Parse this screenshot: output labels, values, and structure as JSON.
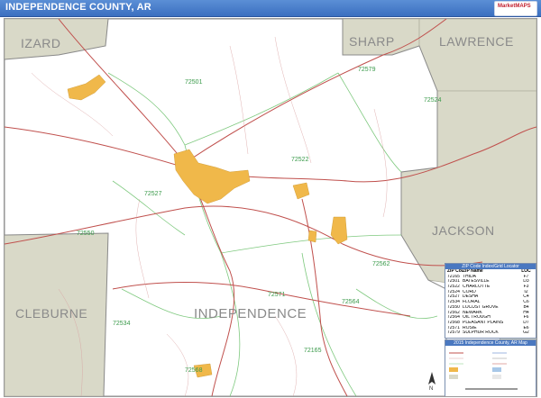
{
  "title": "INDEPENDENCE COUNTY, AR",
  "brand": {
    "name": "MarketMAPS"
  },
  "counties": {
    "izard": "IZARD",
    "sharp": "SHARP",
    "lawrence": "LAWRENCE",
    "jackson": "JACKSON",
    "cleburne": "CLEBURNE",
    "independence": "INDEPENDENCE"
  },
  "zip_labels": [
    "72501",
    "72579",
    "72524",
    "72522",
    "72527",
    "72550",
    "72562",
    "72571",
    "72534",
    "72564",
    "72165",
    "72568"
  ],
  "zip_table": {
    "title": "ZIP Code Index/Grid Locator",
    "headers": [
      "ZIP Code",
      "ZIP Name",
      "LOC"
    ],
    "rows": [
      [
        "72165",
        "THIDA",
        "F7"
      ],
      [
        "72501",
        "BATESVILLE",
        "D3"
      ],
      [
        "72522",
        "CHARLOTTE",
        "F3"
      ],
      [
        "72524",
        "CORD",
        "I2"
      ],
      [
        "72527",
        "DESHA",
        "C4"
      ],
      [
        "72534",
        "FLORAL",
        "C6"
      ],
      [
        "72550",
        "LOCUST GROVE",
        "B4"
      ],
      [
        "72562",
        "NEWARK",
        "H4"
      ],
      [
        "72564",
        "OIL TROUGH",
        "F6"
      ],
      [
        "72568",
        "PLEASANT PLAINS",
        "D7"
      ],
      [
        "72571",
        "ROSIE",
        "E6"
      ],
      [
        "72579",
        "SULPHUR ROCK",
        "G2"
      ]
    ]
  },
  "legend": {
    "title": "2015 Independence County, AR Map"
  },
  "colors": {
    "title_bar": "#3b6fc0",
    "county_fill": "#d9d9c8",
    "city_fill": "#f0b84a",
    "zip_boundary": "#7fc97f",
    "highway": "#c0504d",
    "local_road": "#d8a0a0"
  }
}
